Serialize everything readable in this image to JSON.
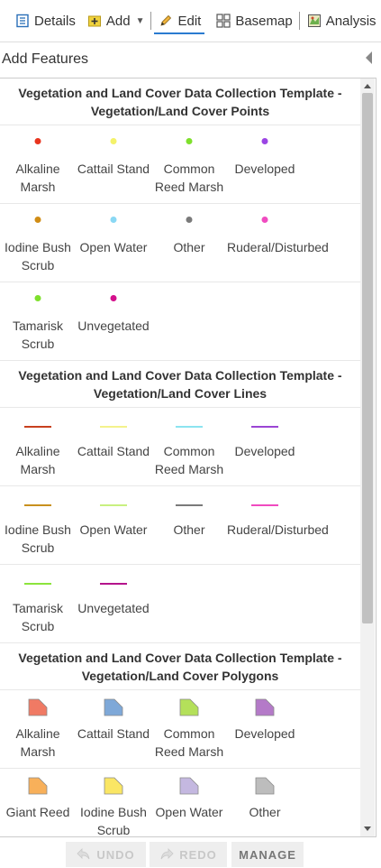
{
  "toolbar": {
    "items": [
      {
        "label": "Details",
        "icon": "details-icon"
      },
      {
        "label": "Add",
        "icon": "add-icon"
      },
      {
        "label": "Edit",
        "icon": "pencil-icon"
      },
      {
        "label": "Basemap",
        "icon": "basemap-icon"
      },
      {
        "label": "Analysis",
        "icon": "analysis-icon"
      }
    ]
  },
  "panel": {
    "title": "Add Features"
  },
  "sections": [
    {
      "title": "Vegetation and Land Cover Data Collection Template - Vegetation/Land Cover Points",
      "symbol": "point",
      "items": [
        {
          "label": "Alkaline Marsh",
          "color": "#e8341e"
        },
        {
          "label": "Cattail Stand",
          "color": "#f4f26a"
        },
        {
          "label": "Common Reed Marsh",
          "color": "#7ee02c"
        },
        {
          "label": "Developed",
          "color": "#9b45e4"
        },
        {
          "label": "Iodine Bush Scrub",
          "color": "#d08c14"
        },
        {
          "label": "Open Water",
          "color": "#8ad8f4"
        },
        {
          "label": "Other",
          "color": "#7a7a7a"
        },
        {
          "label": "Ruderal/Disturbed",
          "color": "#f04bc0"
        },
        {
          "label": "Tamarisk Scrub",
          "color": "#7ee02c"
        },
        {
          "label": "Unvegetated",
          "color": "#d4108c"
        }
      ]
    },
    {
      "title": "Vegetation and Land Cover Data Collection Template - Vegetation/Land Cover Lines",
      "symbol": "line",
      "items": [
        {
          "label": "Alkaline Marsh",
          "color": "#c8401e"
        },
        {
          "label": "Cattail Stand",
          "color": "#f4f28c"
        },
        {
          "label": "Common Reed Marsh",
          "color": "#8ce4f0"
        },
        {
          "label": "Developed",
          "color": "#9b45d4"
        },
        {
          "label": "Iodine Bush Scrub",
          "color": "#c8901e"
        },
        {
          "label": "Open Water",
          "color": "#c8f080"
        },
        {
          "label": "Other",
          "color": "#7a7a7a"
        },
        {
          "label": "Ruderal/Disturbed",
          "color": "#f04bc0"
        },
        {
          "label": "Tamarisk Scrub",
          "color": "#8ce43c"
        },
        {
          "label": "Unvegetated",
          "color": "#b4148c"
        }
      ]
    },
    {
      "title": "Vegetation and Land Cover Data Collection Template - Vegetation/Land Cover Polygons",
      "symbol": "polygon",
      "items": [
        {
          "label": "Alkaline Marsh",
          "color": "#f07a64"
        },
        {
          "label": "Cattail Stand",
          "color": "#7ea8d8"
        },
        {
          "label": "Common Reed Marsh",
          "color": "#b4e05a"
        },
        {
          "label": "Developed",
          "color": "#b47ac8"
        },
        {
          "label": "Giant Reed",
          "color": "#f8b05a"
        },
        {
          "label": "Iodine Bush Scrub",
          "color": "#fae664"
        },
        {
          "label": "Open Water",
          "color": "#c4b8e0"
        },
        {
          "label": "Other",
          "color": "#bdbdbd"
        }
      ]
    }
  ],
  "footer": {
    "undo": "UNDO",
    "redo": "REDO",
    "manage": "MANAGE"
  },
  "colors": {
    "accent": "#2a7bd0"
  }
}
